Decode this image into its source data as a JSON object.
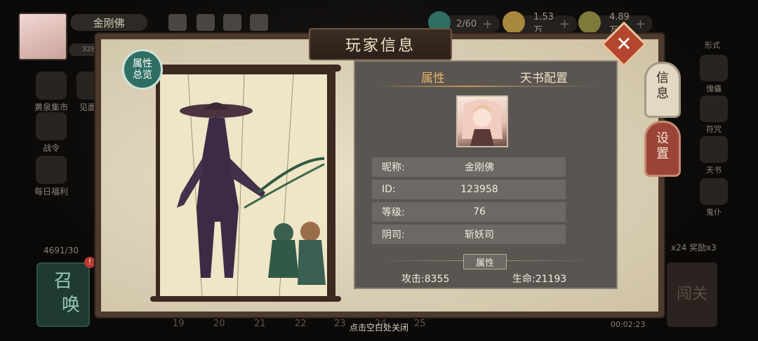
{
  "top_bar": {
    "player_name": "金刚佛",
    "level_badge": "328",
    "resources": [
      {
        "icon": "ghost-lantern-icon",
        "value": "2/60"
      },
      {
        "icon": "gold-ingot-icon",
        "value": "1.53万"
      },
      {
        "icon": "coin-icon",
        "value": "4.89万"
      }
    ]
  },
  "left_menu": [
    {
      "label": "黄泉集市",
      "icon": "market-icon"
    },
    {
      "label": "见面礼",
      "icon": "gift-icon"
    },
    {
      "label": "战令",
      "icon": "battle-pass-icon"
    },
    {
      "label": "每日福利",
      "icon": "daily-bonus-icon"
    }
  ],
  "right_menu": [
    {
      "label": "形式",
      "icon": "form-icon"
    },
    {
      "label": "傀儡",
      "icon": "puppet-icon"
    },
    {
      "label": "符咒",
      "icon": "talisman-icon"
    },
    {
      "label": "天书",
      "icon": "book-icon"
    },
    {
      "label": "鬼仆",
      "icon": "ghost-servant-icon"
    }
  ],
  "bottom": {
    "energy": "4691/30",
    "summon_label_1": "召",
    "summon_label_2": "唤",
    "summon_badge": "!",
    "chapter_numbers": [
      "19",
      "20",
      "21",
      "22",
      "23",
      "24",
      "25"
    ],
    "timer": "00:02:23",
    "reward_text": "x24 奖励x3",
    "right_btn": "闯关"
  },
  "dialog": {
    "title": "玩家信息",
    "close_label": "✕",
    "attr_overview_badge_1": "属性",
    "attr_overview_badge_2": "总览",
    "tabs": [
      {
        "label": "属性",
        "active": true
      },
      {
        "label": "天书配置",
        "active": false
      }
    ],
    "side_tags": [
      {
        "label_1": "信",
        "label_2": "息"
      },
      {
        "label_1": "设",
        "label_2": "置"
      }
    ],
    "fields": [
      {
        "key": "昵称:",
        "value": "金刚佛"
      },
      {
        "key": "ID:",
        "value": "123958"
      },
      {
        "key": "等级:",
        "value": "76"
      },
      {
        "key": "阴司:",
        "value": "斩妖司"
      }
    ],
    "attributes_title": "属性",
    "stats": {
      "attack": "攻击:8355",
      "hp": "生命:21193"
    },
    "hint": "点击空白处关闭"
  },
  "colors": {
    "accent_teal": "#2f6f63",
    "close_red": "#b4452e",
    "tab_active": "#e6b56a",
    "panel_frame": "#4d3a2c"
  }
}
